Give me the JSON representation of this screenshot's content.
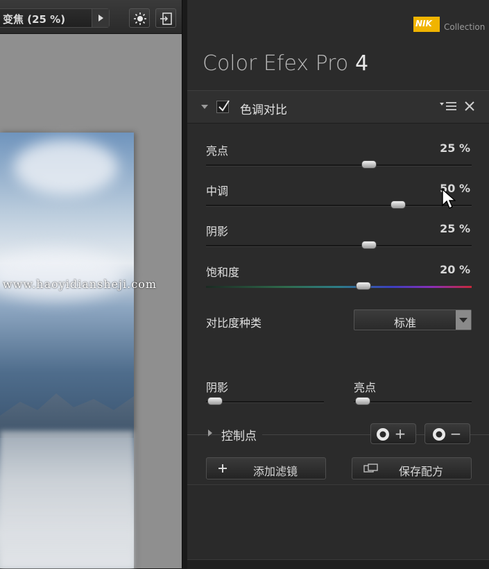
{
  "toolbar": {
    "zoom_label": "变焦 (25 %)",
    "icons": {
      "light": "lightbulb-icon",
      "exit": "exit-icon",
      "zoom_arrow": "triangle-right-icon"
    }
  },
  "watermark": "www.haoyidiansheji.com",
  "branding": {
    "logo_text": "NIK",
    "collection": "Collection",
    "app_title": "Color Efex Pro",
    "app_version": "4"
  },
  "filter": {
    "name": "色调对比",
    "enabled": true,
    "sliders": [
      {
        "label": "亮点",
        "value": "25 %",
        "fraction": 0.61
      },
      {
        "label": "中调",
        "value": "50 %",
        "fraction": 0.72
      },
      {
        "label": "阴影",
        "value": "25 %",
        "fraction": 0.61
      },
      {
        "label": "饱和度",
        "value": "20 %",
        "fraction": 0.59
      }
    ],
    "contrast_type": {
      "label": "对比度种类",
      "value": "标准"
    },
    "protect": [
      {
        "label": "阴影",
        "fraction": 0.07
      },
      {
        "label": "亮点",
        "fraction": 0.07
      }
    ]
  },
  "control_points": {
    "label": "控制点",
    "add_symbol": "+",
    "remove_symbol": "−"
  },
  "actions": {
    "add_filter": "添加滤镜",
    "save_recipe": "保存配方"
  },
  "colors": {
    "accent": "#f0b400",
    "panel": "#2b2b2b"
  }
}
